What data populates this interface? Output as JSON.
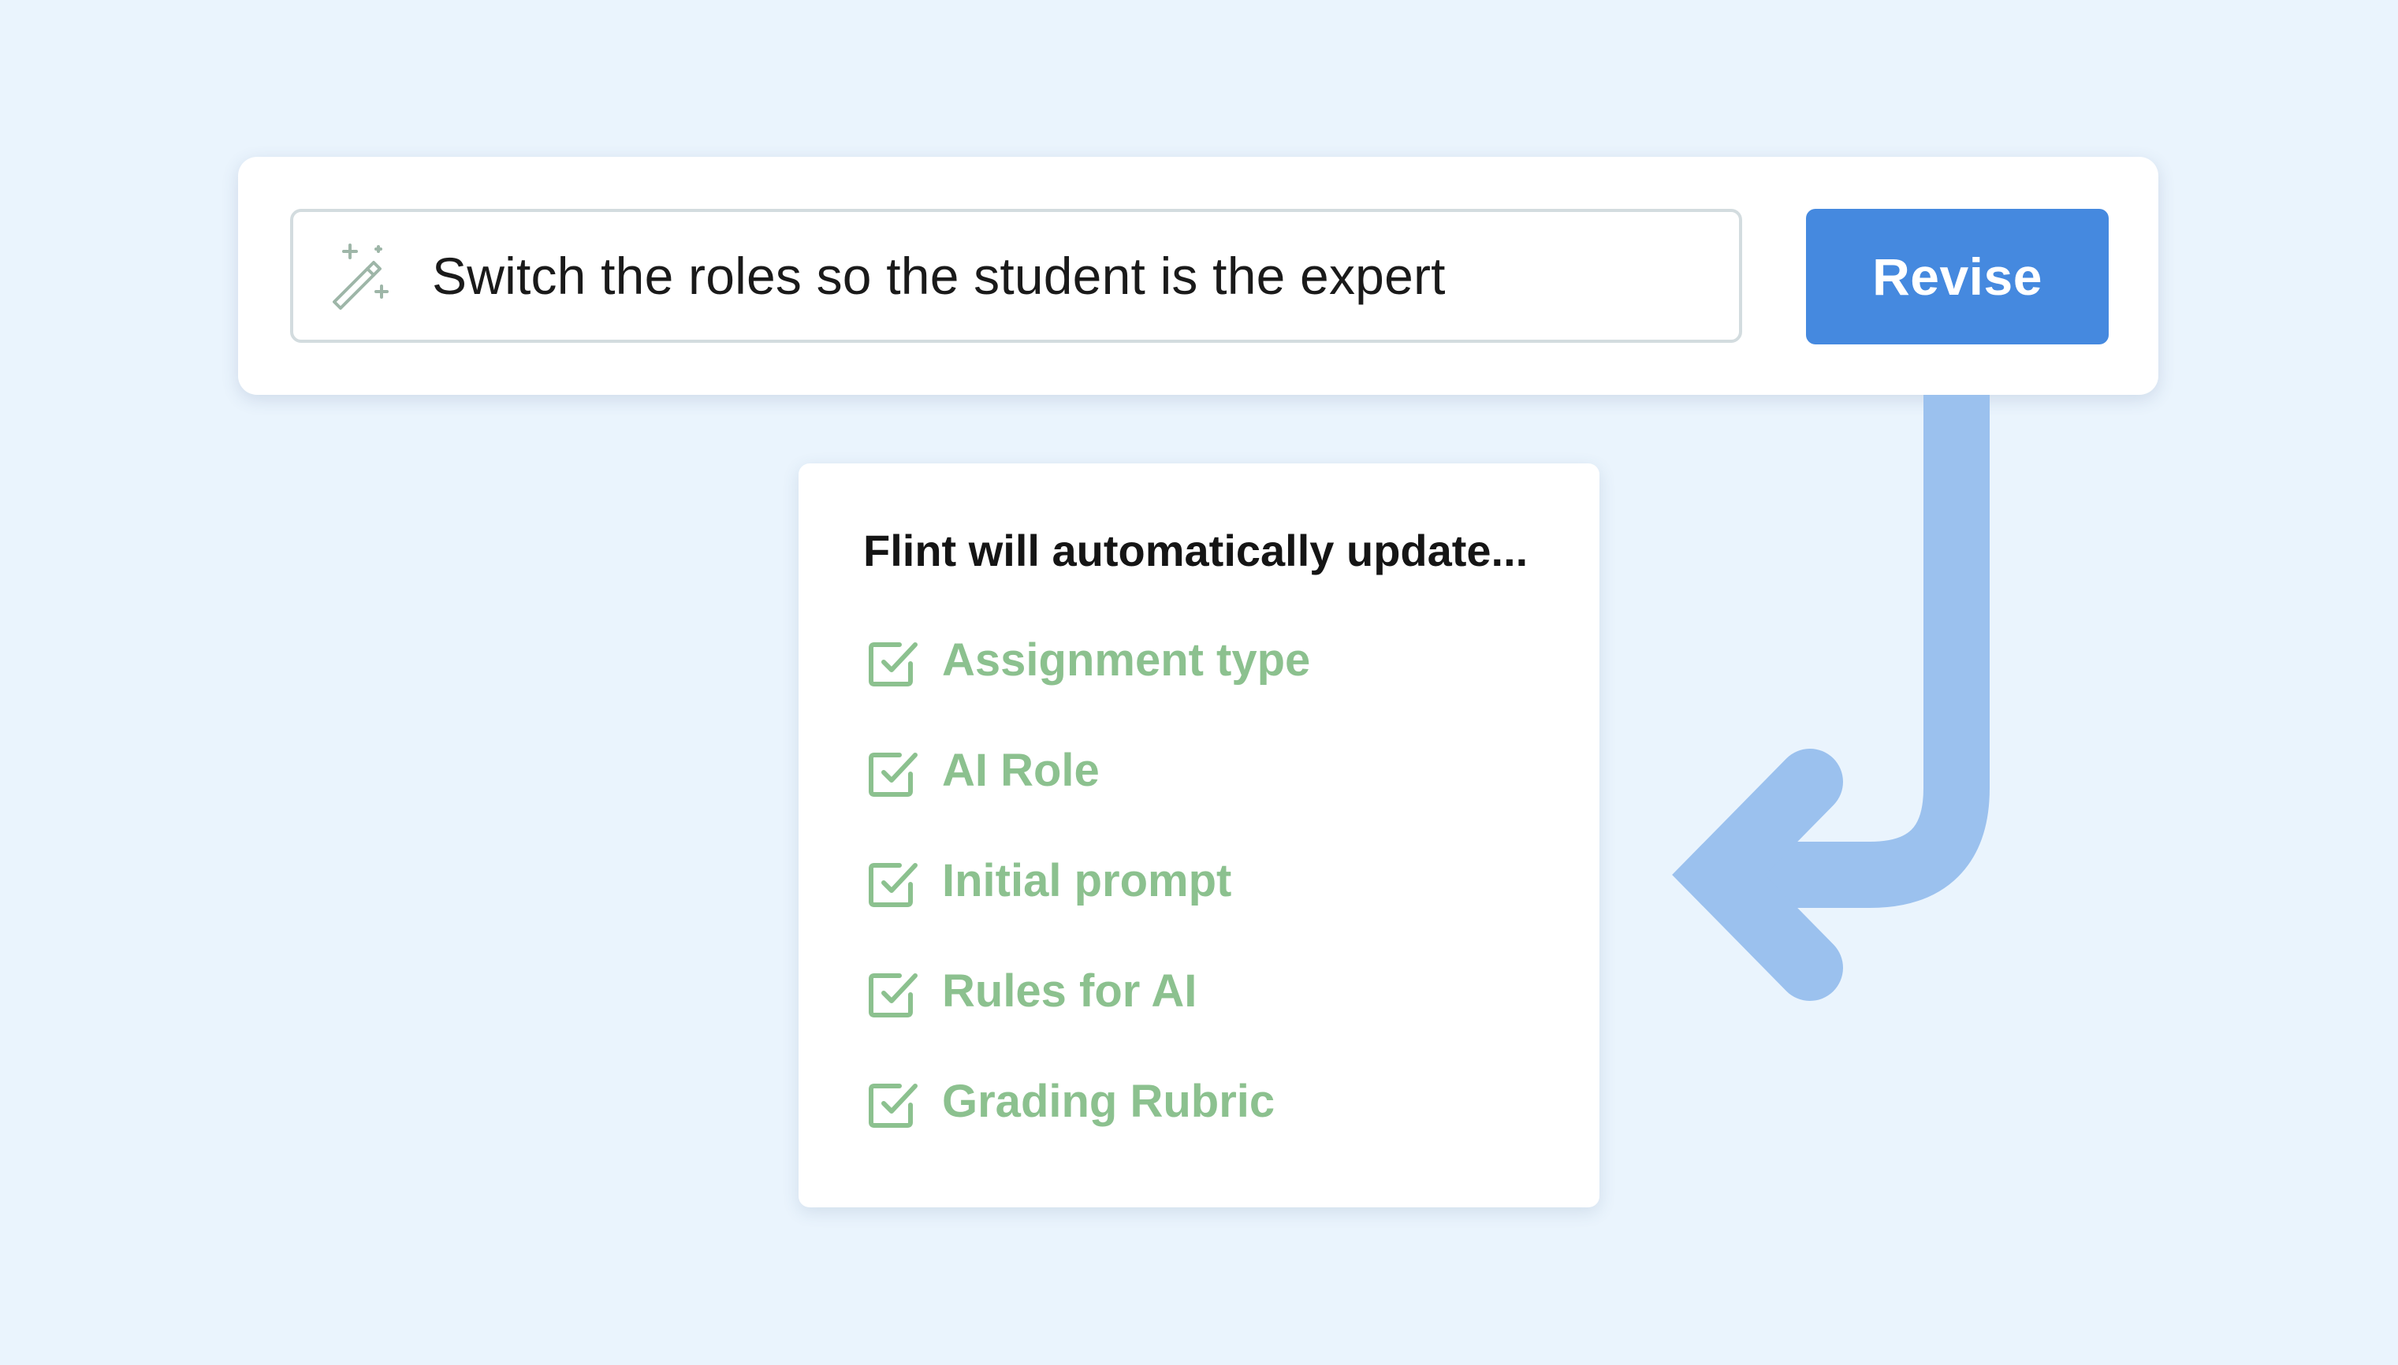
{
  "colors": {
    "background": "#EAF4FD",
    "card": "#FFFFFF",
    "accent_button": "#4589DF",
    "arrow": "#9BC1EE",
    "check_green": "#8CC18F",
    "wand_icon": "#9EB6A8"
  },
  "revise_bar": {
    "input_value": "Switch the roles so the student is the expert",
    "input_icon": "magic-wand-icon",
    "button_label": "Revise"
  },
  "connector": {
    "icon": "curved-arrow-left-icon"
  },
  "updates_panel": {
    "title": "Flint will automatically update...",
    "item_icon": "checked-box-icon",
    "items": [
      {
        "label": "Assignment type",
        "checked": true
      },
      {
        "label": "AI Role",
        "checked": true
      },
      {
        "label": "Initial prompt",
        "checked": true
      },
      {
        "label": "Rules for AI",
        "checked": true
      },
      {
        "label": "Grading Rubric",
        "checked": true
      }
    ]
  }
}
